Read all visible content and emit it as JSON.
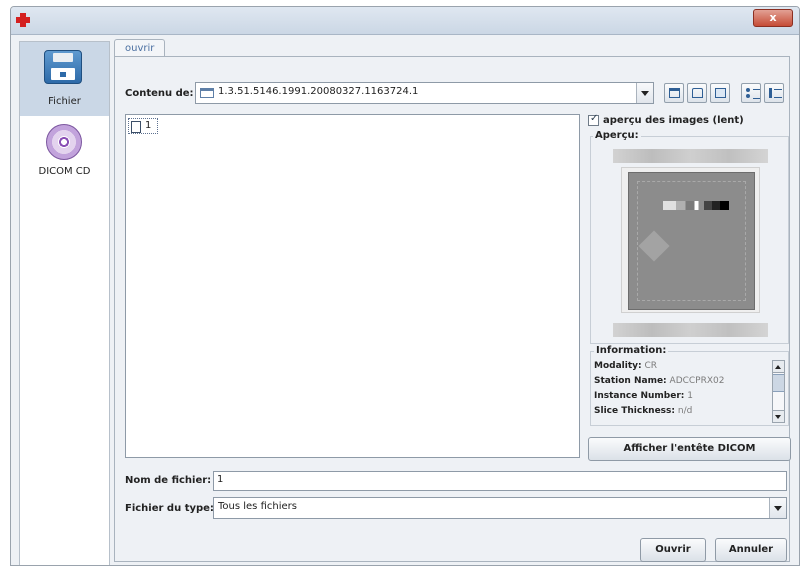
{
  "window": {
    "close_glyph": "x",
    "app_icon": "red-cross-icon"
  },
  "sidebar": {
    "items": [
      {
        "label": "Fichier",
        "icon": "floppy-disk-icon",
        "selected": true
      },
      {
        "label": "DICOM CD",
        "icon": "cd-disc-icon",
        "selected": false
      }
    ]
  },
  "tabs": [
    {
      "label": "ouvrir",
      "active": true
    }
  ],
  "lookin": {
    "label": "Contenu de:",
    "value": "1.3.51.5146.1991.20080327.1163724.1",
    "icon": "folder-icon"
  },
  "toolbar": {
    "icons": [
      "up-folder-icon",
      "home-icon",
      "new-folder-icon",
      "list-view-icon",
      "details-view-icon"
    ]
  },
  "files": [
    {
      "name": "1",
      "icon": "file-icon"
    }
  ],
  "preview": {
    "checkbox_label": "aperçu des images (lent)",
    "checked": true,
    "title": "Aperçu:"
  },
  "information": {
    "title": "Information:",
    "lines": [
      {
        "key": "Modality:",
        "value": "CR"
      },
      {
        "key": "Station Name:",
        "value": "ADCCPRX02"
      },
      {
        "key": "Instance Number:",
        "value": "1"
      },
      {
        "key": "Slice Thickness:",
        "value": "n/d"
      }
    ],
    "button_label": "Afficher l'entête DICOM"
  },
  "filename": {
    "label": "Nom de fichier:",
    "value": "1"
  },
  "filetype": {
    "label": "Fichier du type:",
    "value": "Tous les fichiers"
  },
  "actions": {
    "open_label": "Ouvrir",
    "cancel_label": "Annuler"
  }
}
